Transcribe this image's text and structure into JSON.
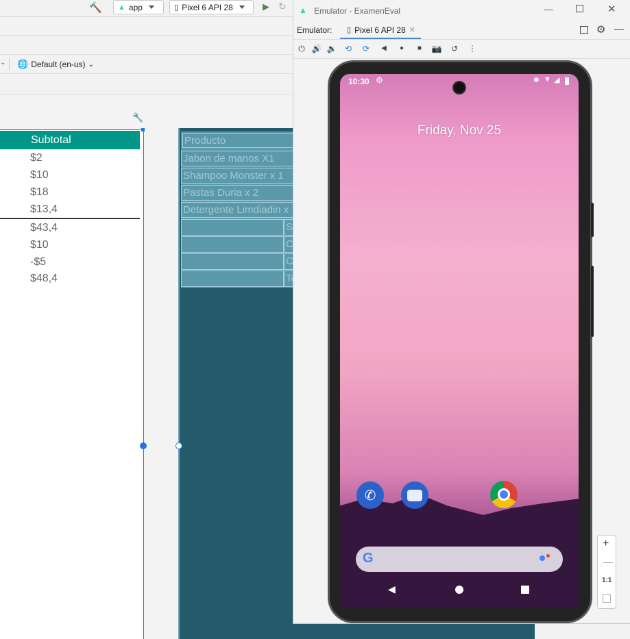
{
  "ide": {
    "run_config": "app",
    "device": "Pixel 6 API 28",
    "locale": "Default (en-us)"
  },
  "layout_preview": {
    "header": "Subtotal",
    "values_top": [
      "$2",
      "$10",
      "$18",
      "$13,4"
    ],
    "values_bottom": [
      "$43,4",
      "$10",
      "-$5",
      "$48,4"
    ]
  },
  "blueprint": {
    "rows": [
      "Producto",
      "Jabon de manos X1",
      "Shampoo Monster x 1",
      "Pastas Duria x 2",
      "Detergente Limdiadin x"
    ],
    "side_cells": [
      "S",
      "C",
      "C",
      "To"
    ]
  },
  "emulator": {
    "title": "Emulator - ExamenEval",
    "tabs_label": "Emulator:",
    "tab_name": "Pixel 6 API 28",
    "zoom_ratio": "1:1"
  },
  "phone": {
    "time": "10:30",
    "date": "Friday, Nov 25"
  },
  "colors": {
    "teal": "#009788",
    "blueprint": "#245a6a",
    "selection": "#2a6fd6"
  }
}
